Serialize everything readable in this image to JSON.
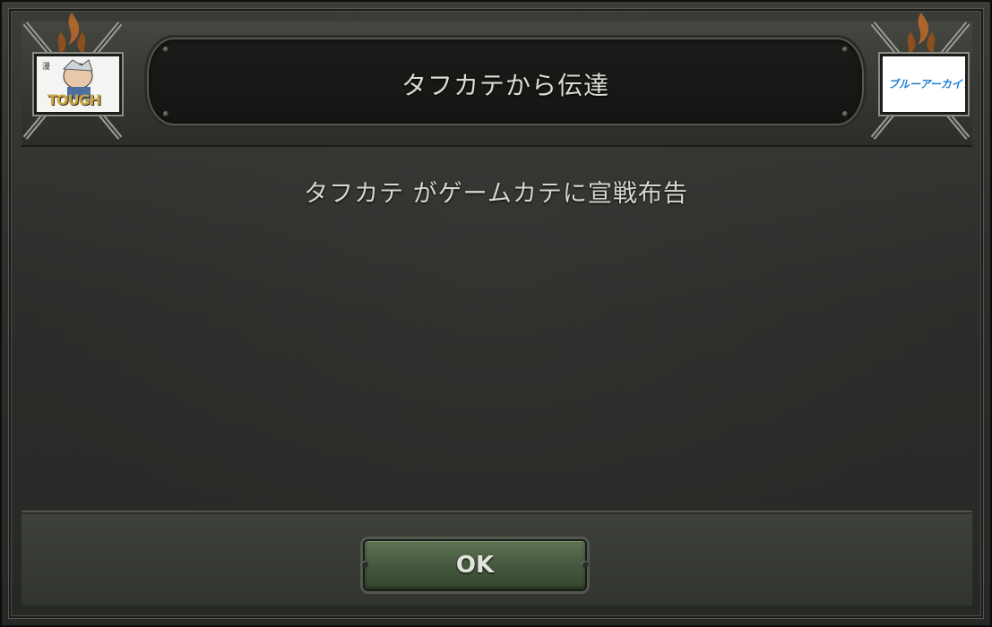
{
  "dialog": {
    "title": "タフカテから伝達",
    "message_sender": "タフカテ",
    "message_rest": "がゲームカテに宣戦布告",
    "ok_label": "OK"
  },
  "flags": {
    "left": {
      "text": "TOUGH",
      "icon": "tough-flag-icon"
    },
    "right": {
      "text": "ブルーアーカイブ",
      "icon": "blue-archive-flag-icon"
    }
  },
  "colors": {
    "title_text": "#dcdcd6",
    "button_green": "#44573d",
    "flame": "#b8682a"
  }
}
